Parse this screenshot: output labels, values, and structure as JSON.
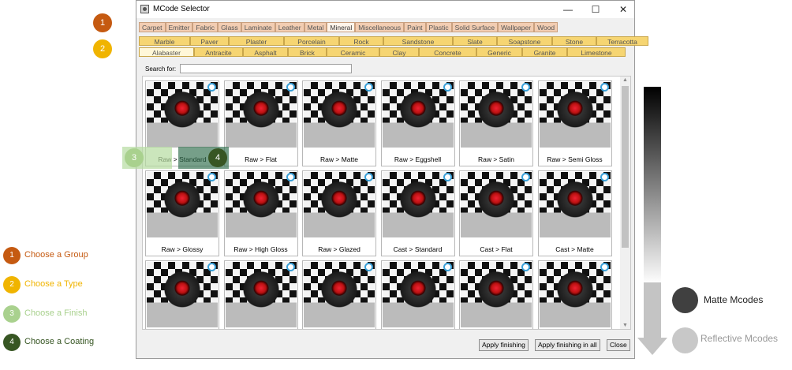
{
  "window": {
    "title": "MCode Selector",
    "minimize": "—",
    "maximize": "☐",
    "close": "✕"
  },
  "groups": [
    "Carpet",
    "Emitter",
    "Fabric",
    "Glass",
    "Laminate",
    "Leather",
    "Metal",
    "Mineral",
    "Miscellaneous",
    "Paint",
    "Plastic",
    "Solid Surface",
    "Wallpaper",
    "Wood"
  ],
  "active_group": "Mineral",
  "types_row1": [
    "Marble",
    "Paver",
    "Plaster",
    "Porcelain",
    "Rock",
    "Sandstone",
    "Slate",
    "Soapstone",
    "Stone",
    "Terracotta"
  ],
  "types_row2": [
    "Alabaster",
    "Antracite",
    "Asphalt",
    "Brick",
    "Ceramic",
    "Clay",
    "Concrete",
    "Generic",
    "Granite",
    "Limestone"
  ],
  "active_type": "Alabaster",
  "search": {
    "label": "Search for:",
    "value": ""
  },
  "tiles": [
    "Raw > Standard",
    "Raw > Flat",
    "Raw > Matte",
    "Raw > Eggshell",
    "Raw > Satin",
    "Raw > Semi Gloss",
    "Raw > Glossy",
    "Raw > High Gloss",
    "Raw > Glazed",
    "Cast > Standard",
    "Cast > Flat",
    "Cast > Matte",
    "",
    "",
    "",
    "",
    "",
    ""
  ],
  "buttons": {
    "apply": "Apply finishing",
    "apply_all": "Apply finishing in all",
    "close": "Close"
  },
  "badges": {
    "b1": "1",
    "b2": "2",
    "b3": "3",
    "b4": "4"
  },
  "legend": [
    {
      "num": "1",
      "text": "Choose a Group",
      "color": "#c55a11"
    },
    {
      "num": "2",
      "text": "Choose a Type",
      "color": "#f0b400"
    },
    {
      "num": "3",
      "text": "Choose a Finish",
      "color": "#a9d18e"
    },
    {
      "num": "4",
      "text": "Choose a Coating",
      "color": "#375623"
    }
  ],
  "scale": {
    "matte": "Matte Mcodes",
    "reflective": "Reflective Mcodes"
  }
}
